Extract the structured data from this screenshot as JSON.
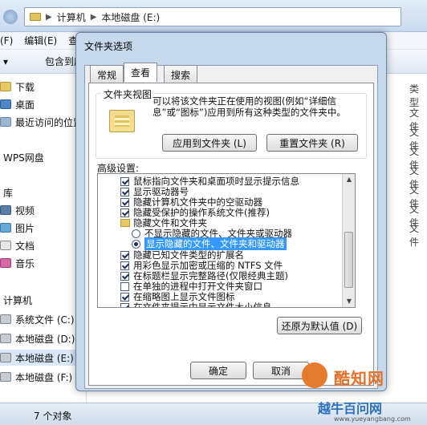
{
  "explorer": {
    "breadcrumb": [
      "计算机",
      "本地磁盘 (E:)"
    ],
    "menu": [
      "(F)",
      "编辑(E)",
      "查"
    ],
    "toolbar": [
      "包含到库"
    ],
    "nav": [
      {
        "label": "下载",
        "icon": "folder-icon"
      },
      {
        "label": "桌面",
        "icon": "desktop-icon"
      },
      {
        "label": "最近访问的位置",
        "icon": "recent-icon"
      },
      {
        "label": "WPS网盘",
        "icon": "cloud-icon"
      },
      {
        "label": "库",
        "icon": "library-icon"
      },
      {
        "label": "视频",
        "icon": "video-icon"
      },
      {
        "label": "图片",
        "icon": "picture-icon"
      },
      {
        "label": "文档",
        "icon": "document-icon"
      },
      {
        "label": "音乐",
        "icon": "music-icon"
      },
      {
        "label": "计算机",
        "icon": "computer-icon"
      },
      {
        "label": "系统文件 (C:)",
        "icon": "drive-icon"
      },
      {
        "label": "本地磁盘 (D:)",
        "icon": "drive-icon"
      },
      {
        "label": "本地磁盘 (E:)",
        "icon": "drive-icon"
      },
      {
        "label": "本地磁盘 (F:)",
        "icon": "drive-icon"
      }
    ],
    "type_header": "类型",
    "type_values": [
      "文件",
      "文件",
      "文件",
      "文件",
      "文件",
      "文件",
      "文件"
    ],
    "status": "7 个对象"
  },
  "dialog": {
    "title": "文件夹选项",
    "tabs": [
      "常规",
      "查看",
      "搜索"
    ],
    "folder_view": {
      "group_label": "文件夹视图",
      "description": "可以将该文件夹正在使用的视图(例如“详细信息”或“图标”)应用到所有这种类型的文件夹中。",
      "apply_button": "应用到文件夹 (L)",
      "reset_button": "重置文件夹 (R)"
    },
    "advanced_label": "高级设置:",
    "settings": [
      {
        "type": "checkbox",
        "checked": true,
        "label": "鼠标指向文件夹和桌面项时显示提示信息"
      },
      {
        "type": "checkbox",
        "checked": true,
        "label": "显示驱动器号"
      },
      {
        "type": "checkbox",
        "checked": true,
        "label": "隐藏计算机文件夹中的空驱动器"
      },
      {
        "type": "checkbox",
        "checked": true,
        "label": "隐藏受保护的操作系统文件(推荐)"
      },
      {
        "type": "folder",
        "label": "隐藏文件和文件夹"
      },
      {
        "type": "radio",
        "checked": false,
        "label": "不显示隐藏的文件、文件夹或驱动器"
      },
      {
        "type": "radio",
        "checked": true,
        "label": "显示隐藏的文件、文件夹和驱动器",
        "selected": true
      },
      {
        "type": "checkbox",
        "checked": true,
        "label": "隐藏已知文件类型的扩展名"
      },
      {
        "type": "checkbox",
        "checked": true,
        "label": "用彩色显示加密或压缩的 NTFS 文件"
      },
      {
        "type": "checkbox",
        "checked": true,
        "label": "在标题栏显示完整路径(仅限经典主题)"
      },
      {
        "type": "checkbox",
        "checked": false,
        "label": "在单独的进程中打开文件夹窗口"
      },
      {
        "type": "checkbox",
        "checked": true,
        "label": "在缩略图上显示文件图标"
      },
      {
        "type": "checkbox",
        "checked": true,
        "label": "在文件夹提示中显示文件大小信息"
      }
    ],
    "restore_button": "还原为默认值 (D)",
    "ok_button": "确定",
    "cancel_button": "取消"
  },
  "watermark": {
    "brand": "酷知网",
    "slogan": "越牛百问网",
    "url": "www.yueyangbang.com"
  }
}
